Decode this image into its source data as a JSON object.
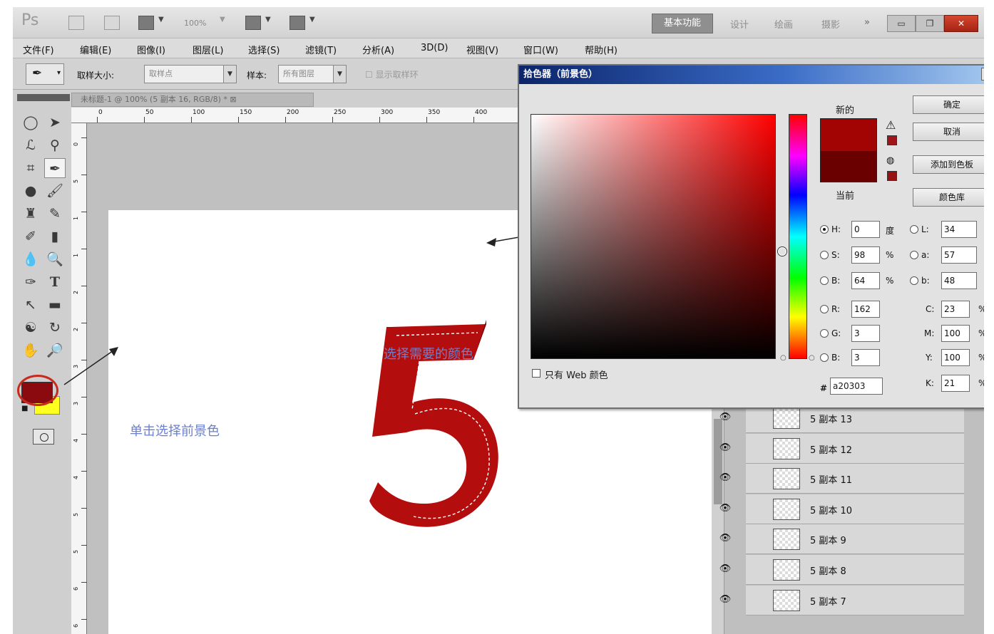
{
  "titlebar": {
    "logo": "Ps",
    "zoom": "100%",
    "workspace_active": "基本功能",
    "workspaces": [
      "设计",
      "绘画",
      "摄影"
    ],
    "more": "»"
  },
  "menu": [
    "文件(F)",
    "编辑(E)",
    "图像(I)",
    "图层(L)",
    "选择(S)",
    "滤镜(T)",
    "分析(A)",
    "3D(D)",
    "视图(V)",
    "窗口(W)",
    "帮助(H)"
  ],
  "options": {
    "sample_size_label": "取样大小:",
    "sample_size_value": "取样点",
    "sample_label": "样本:",
    "sample_value": "所有图层",
    "show_ring_label": "显示取样环"
  },
  "document": {
    "tab_title": "未标题-1 @ 100% (5 副本 16, RGB/8) * ",
    "ruler_top": [
      "0",
      "50",
      "100",
      "150",
      "200",
      "250",
      "300",
      "350",
      "400"
    ],
    "ruler_left": [
      "0",
      "5",
      "1",
      "1",
      "2",
      "2",
      "3",
      "3",
      "4",
      "4",
      "5",
      "5",
      "6",
      "6"
    ]
  },
  "canvas": {
    "digit": "5",
    "annotation_pick": "选择需要的颜色",
    "annotation_fg": "单击选择前景色",
    "digit_color": "#b40d0d"
  },
  "layers": [
    {
      "name": "5 副本 13"
    },
    {
      "name": "5 副本 12"
    },
    {
      "name": "5 副本 11"
    },
    {
      "name": "5 副本 10"
    },
    {
      "name": "5 副本 9"
    },
    {
      "name": "5 副本 8"
    },
    {
      "name": "5 副本 7"
    }
  ],
  "picker": {
    "title": "拾色器（前景色）",
    "close": "X",
    "label_new": "新的",
    "label_current": "当前",
    "btn_ok": "确定",
    "btn_cancel": "取消",
    "btn_add_swatch": "添加到色板",
    "btn_libraries": "颜色库",
    "web_only": "只有 Web 颜色",
    "fields": {
      "H": "0",
      "S": "98",
      "B": "64",
      "R": "162",
      "G": "3",
      "B2": "3",
      "L": "34",
      "a": "57",
      "b": "48",
      "C": "23",
      "M": "100",
      "Y": "100",
      "K": "21"
    },
    "units": {
      "deg": "度",
      "pct": "%"
    },
    "hex_label": "#",
    "hex": "a20303",
    "new_color": "#a20303",
    "current_color": "#6b0000"
  }
}
